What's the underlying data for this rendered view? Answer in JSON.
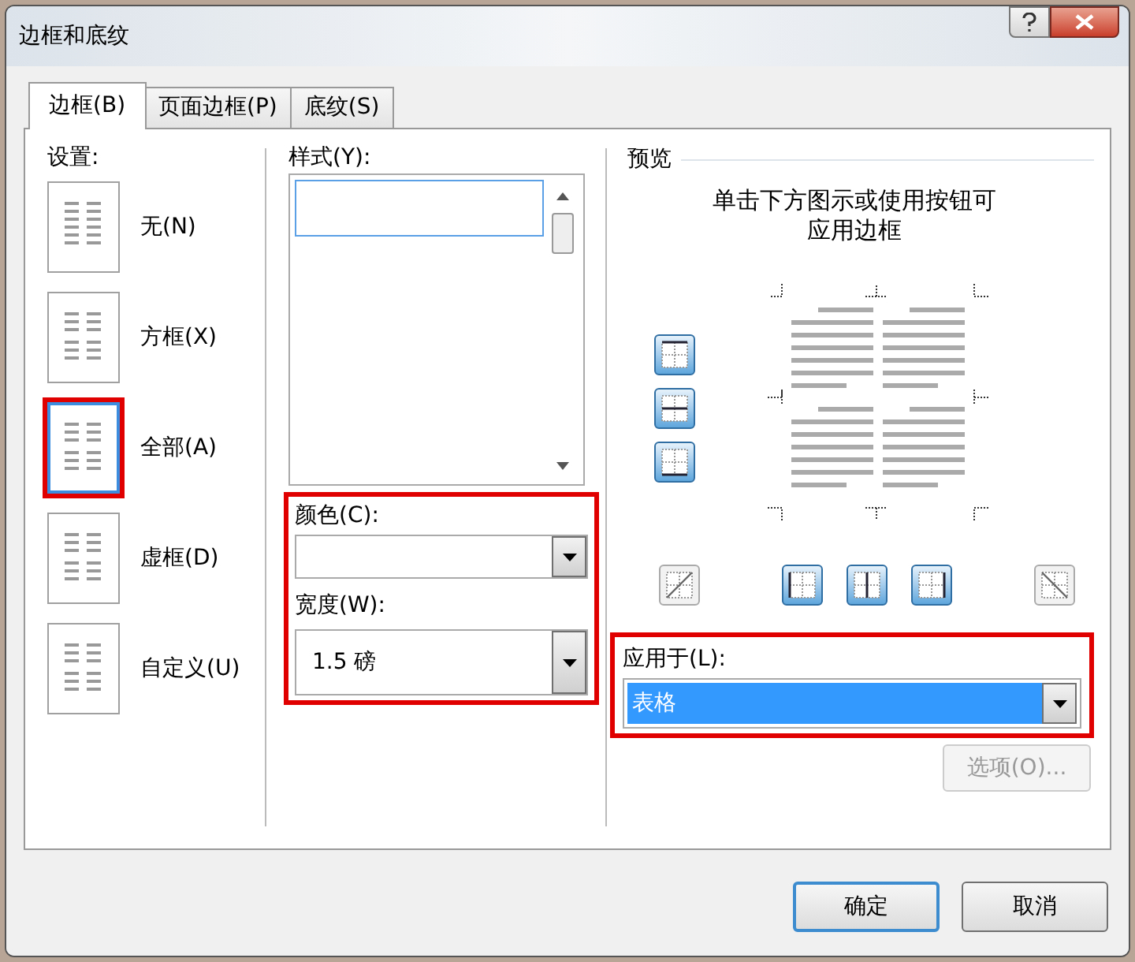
{
  "window": {
    "title": "边框和底纹"
  },
  "tabs": [
    {
      "label": "边框(B)",
      "selected": true
    },
    {
      "label": "页面边框(P)",
      "selected": false
    },
    {
      "label": "底纹(S)",
      "selected": false
    }
  ],
  "settings": {
    "label": "设置:",
    "items": [
      {
        "label": "无(N)",
        "kind": "none",
        "selected": false,
        "highlighted": false
      },
      {
        "label": "方框(X)",
        "kind": "box",
        "selected": false,
        "highlighted": false
      },
      {
        "label": "全部(A)",
        "kind": "all",
        "selected": true,
        "highlighted": true
      },
      {
        "label": "虚框(D)",
        "kind": "grid",
        "selected": false,
        "highlighted": false
      },
      {
        "label": "自定义(U)",
        "kind": "custom",
        "selected": false,
        "highlighted": false
      }
    ]
  },
  "style": {
    "label": "样式(Y):"
  },
  "line_group": {
    "highlighted": true,
    "color": {
      "label": "颜色(C):"
    },
    "width": {
      "label": "宽度(W):",
      "value": "1.5 磅"
    }
  },
  "preview": {
    "title": "预览",
    "hint": "单击下方图示或使用按钮可应用边框"
  },
  "apply_to": {
    "label": "应用于(L):",
    "value": "表格",
    "highlighted": true
  },
  "options_button": {
    "label": "选项(O)...",
    "disabled": true
  },
  "buttons": [
    {
      "label": "确定",
      "kind": "default"
    },
    {
      "label": "取消",
      "kind": "normal"
    }
  ]
}
